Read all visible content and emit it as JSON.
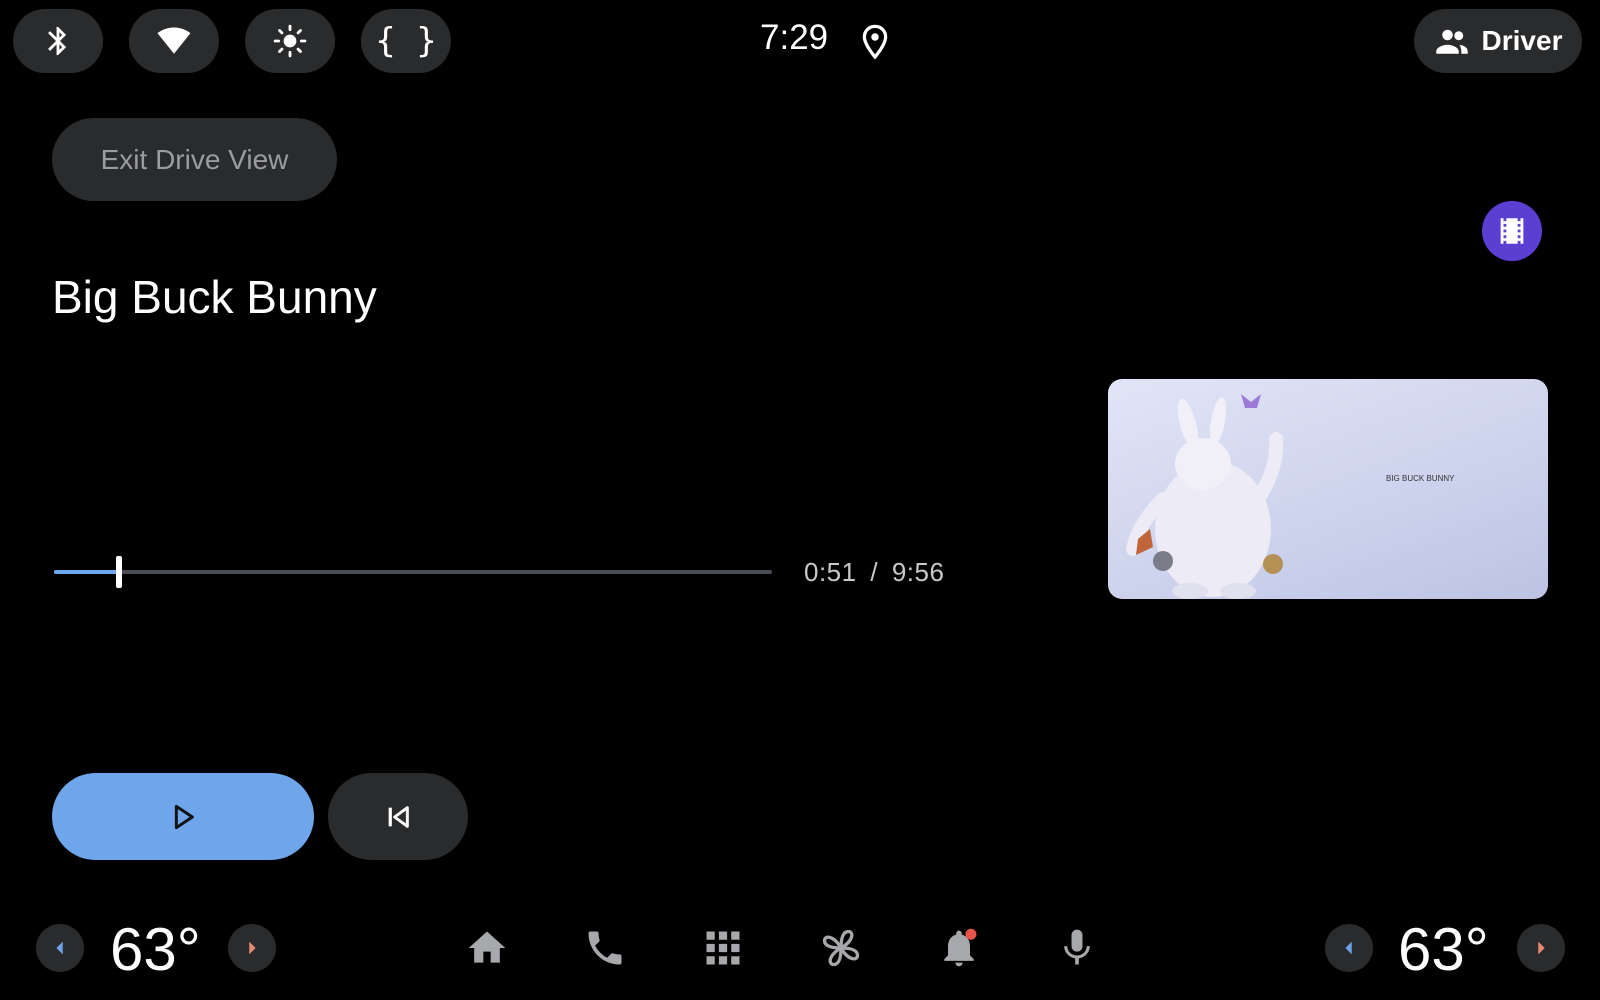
{
  "status_bar": {
    "clock": "7:29",
    "quick_settings": [
      "bluetooth-icon",
      "wifi-icon",
      "brightness-icon",
      "debug-braces-icon"
    ],
    "profile_label": "Driver"
  },
  "media": {
    "exit_label": "Exit Drive View",
    "title": "Big Buck Bunny",
    "elapsed": "0:51",
    "separator": "/",
    "duration": "9:56",
    "progress_fraction": 0.09,
    "accent_color": "#6fa5ea",
    "artwork_text": "BIG BUCK BUNNY"
  },
  "bottom_bar": {
    "left_temp": "63°",
    "right_temp": "63°",
    "nav": [
      "home-icon",
      "phone-icon",
      "app-grid-icon",
      "fan-icon",
      "notifications-icon",
      "microphone-icon"
    ],
    "notification_dot_color": "#e5534b"
  }
}
